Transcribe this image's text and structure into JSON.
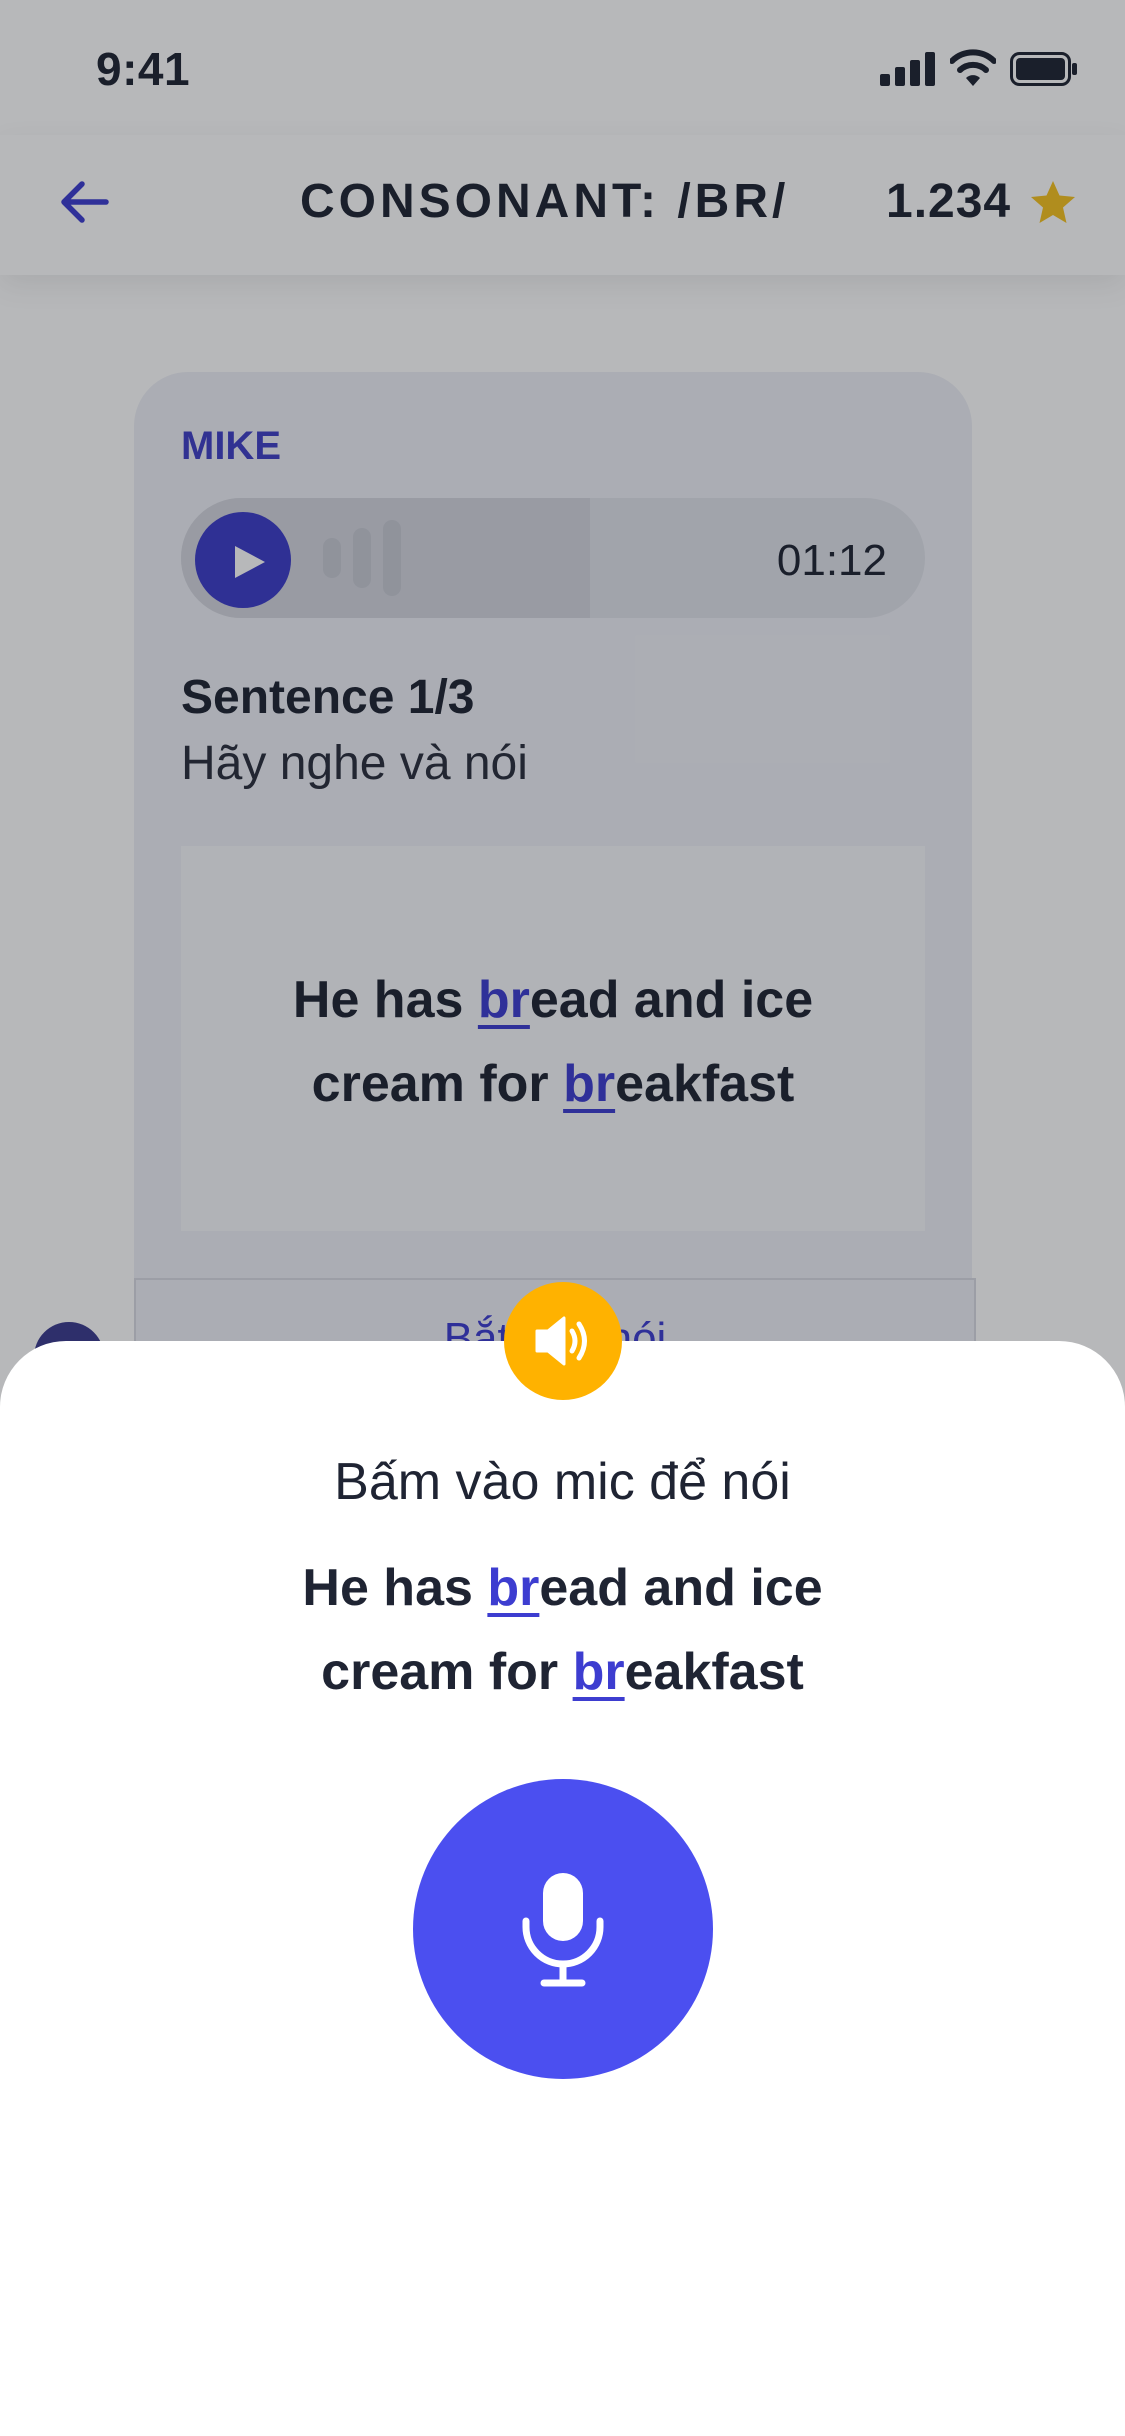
{
  "status_bar": {
    "time": "9:41",
    "icons": [
      "signal-icon",
      "wifi-icon",
      "battery-icon"
    ]
  },
  "nav": {
    "back_icon": "arrow-left-icon",
    "title": "CONSONANT: /BR/",
    "score": "1.234",
    "score_icon": "star-icon"
  },
  "card": {
    "speaker_name": "MIKE",
    "audio": {
      "duration": "01:12",
      "progress": 0.55
    },
    "sentence_counter": "Sentence 1/3",
    "instruction": "Hãy nghe và nói",
    "sentence": {
      "lines": [
        [
          {
            "t": "He has "
          },
          {
            "t": "br",
            "hl": true
          },
          {
            "t": "ead and ice"
          }
        ],
        [
          {
            "t": "cream for "
          },
          {
            "t": "br",
            "hl": true
          },
          {
            "t": "eakfast"
          }
        ]
      ]
    },
    "start_speak_label": "Bắt đầu nói"
  },
  "sheet": {
    "instruction": "Bấm vào mic để nói",
    "speaker_icon": "speaker-icon",
    "mic_icon": "microphone-icon"
  },
  "colors": {
    "accent": "#3d3dd0",
    "mic": "#4b4ff0",
    "speaker": "#ffb200",
    "star": "#f5c220"
  }
}
